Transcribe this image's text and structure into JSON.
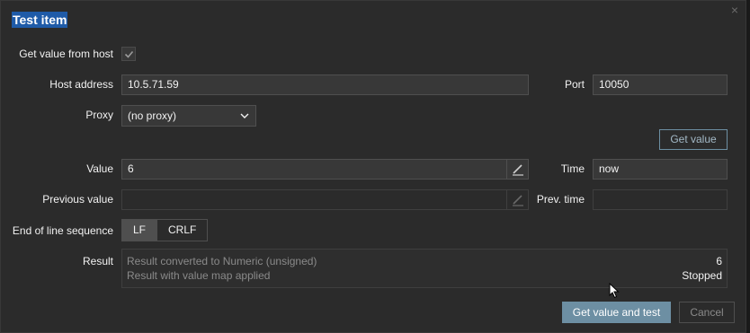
{
  "dialog": {
    "title": "Test item",
    "close_glyph": "×"
  },
  "form": {
    "get_value_from_host_label": "Get value from host",
    "get_value_from_host_checked": true,
    "host_address_label": "Host address",
    "host_address_value": "10.5.71.59",
    "port_label": "Port",
    "port_value": "10050",
    "proxy_label": "Proxy",
    "proxy_value": "(no proxy)",
    "get_value_button": "Get value",
    "value_label": "Value",
    "value_value": "6",
    "time_label": "Time",
    "time_value": "now",
    "previous_value_label": "Previous value",
    "previous_value_value": "",
    "prev_time_label": "Prev. time",
    "prev_time_value": "",
    "eol_label": "End of line sequence",
    "eol_options": [
      "LF",
      "CRLF"
    ],
    "eol_selected": "LF",
    "result_label": "Result",
    "result_rows": [
      {
        "label": "Result converted to Numeric (unsigned)",
        "value": "6"
      },
      {
        "label": "Result with value map applied",
        "value": "Stopped"
      }
    ]
  },
  "footer": {
    "primary_button": "Get value and test",
    "cancel_button": "Cancel"
  },
  "colors": {
    "background": "#2b2b2b",
    "title_highlight": "#1f5ba8",
    "accent": "#6d8fa3",
    "input_bg": "#383838"
  },
  "icons": {
    "checkbox": "checkmark-icon",
    "proxy_dropdown": "chevron-down-icon",
    "value_edit": "pencil-icon",
    "previous_value_edit": "pencil-icon",
    "close": "close-icon",
    "cursor": "mouse-pointer-icon"
  }
}
